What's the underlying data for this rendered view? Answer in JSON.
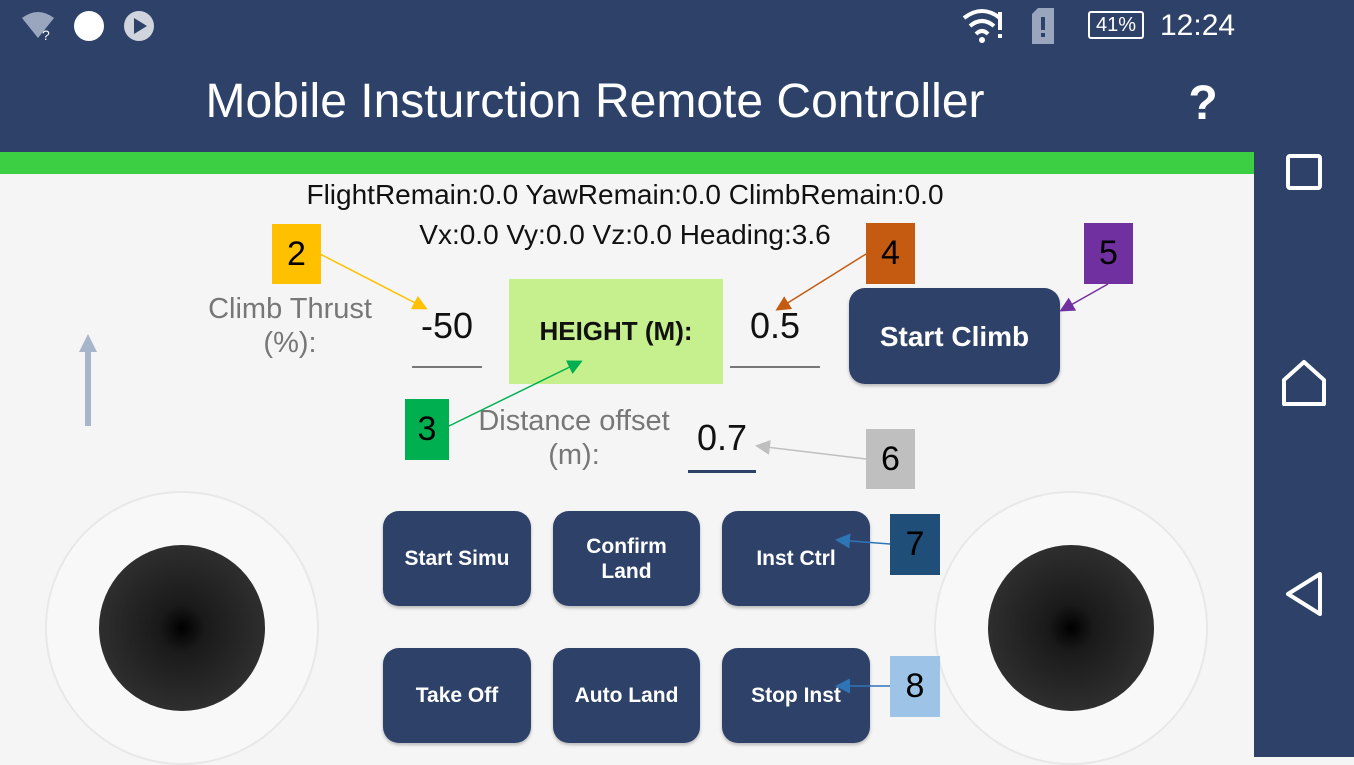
{
  "statusbar": {
    "battery": "41%",
    "time": "12:24",
    "icons": [
      "wifi-question-icon",
      "notification-dot-icon",
      "play-icon",
      "wifi-alert-icon",
      "sim-alert-icon",
      "battery-icon"
    ]
  },
  "appbar": {
    "title": "Mobile Insturction Remote Controller",
    "help": "?"
  },
  "telemetry": {
    "line1": "FlightRemain:0.0 YawRemain:0.0 ClimbRemain:0.0",
    "line2": "Vx:0.0 Vy:0.0 Vz:0.0 Heading:3.6"
  },
  "controls": {
    "climb_thrust_label_1": "Climb Thrust",
    "climb_thrust_label_2": "(%):",
    "climb_thrust_value": "-50",
    "height_label": "HEIGHT (M):",
    "height_value": "0.5",
    "start_climb": "Start Climb",
    "distance_label_1": "Distance offset",
    "distance_label_2": "(m):",
    "distance_value": "0.7"
  },
  "buttons": {
    "start_simu": "Start Simu",
    "confirm_land_1": "Confirm",
    "confirm_land_2": "Land",
    "inst_ctrl": "Inst Ctrl",
    "take_off": "Take Off",
    "auto_land": "Auto Land",
    "stop_inst": "Stop Inst"
  },
  "annotations": {
    "tag2": "2",
    "tag3": "3",
    "tag4": "4",
    "tag5": "5",
    "tag6": "6",
    "tag7": "7",
    "tag8": "8"
  },
  "colors": {
    "primary": "#2e4269",
    "accent_green": "#3ccf44",
    "height_box": "#c6f08e",
    "tag2": "#ffc000",
    "tag3": "#00b050",
    "tag4": "#c55a11",
    "tag5": "#7030a0",
    "tag6": "#bfbfbf",
    "tag7": "#1f4e79",
    "tag8": "#9dc3e6"
  }
}
